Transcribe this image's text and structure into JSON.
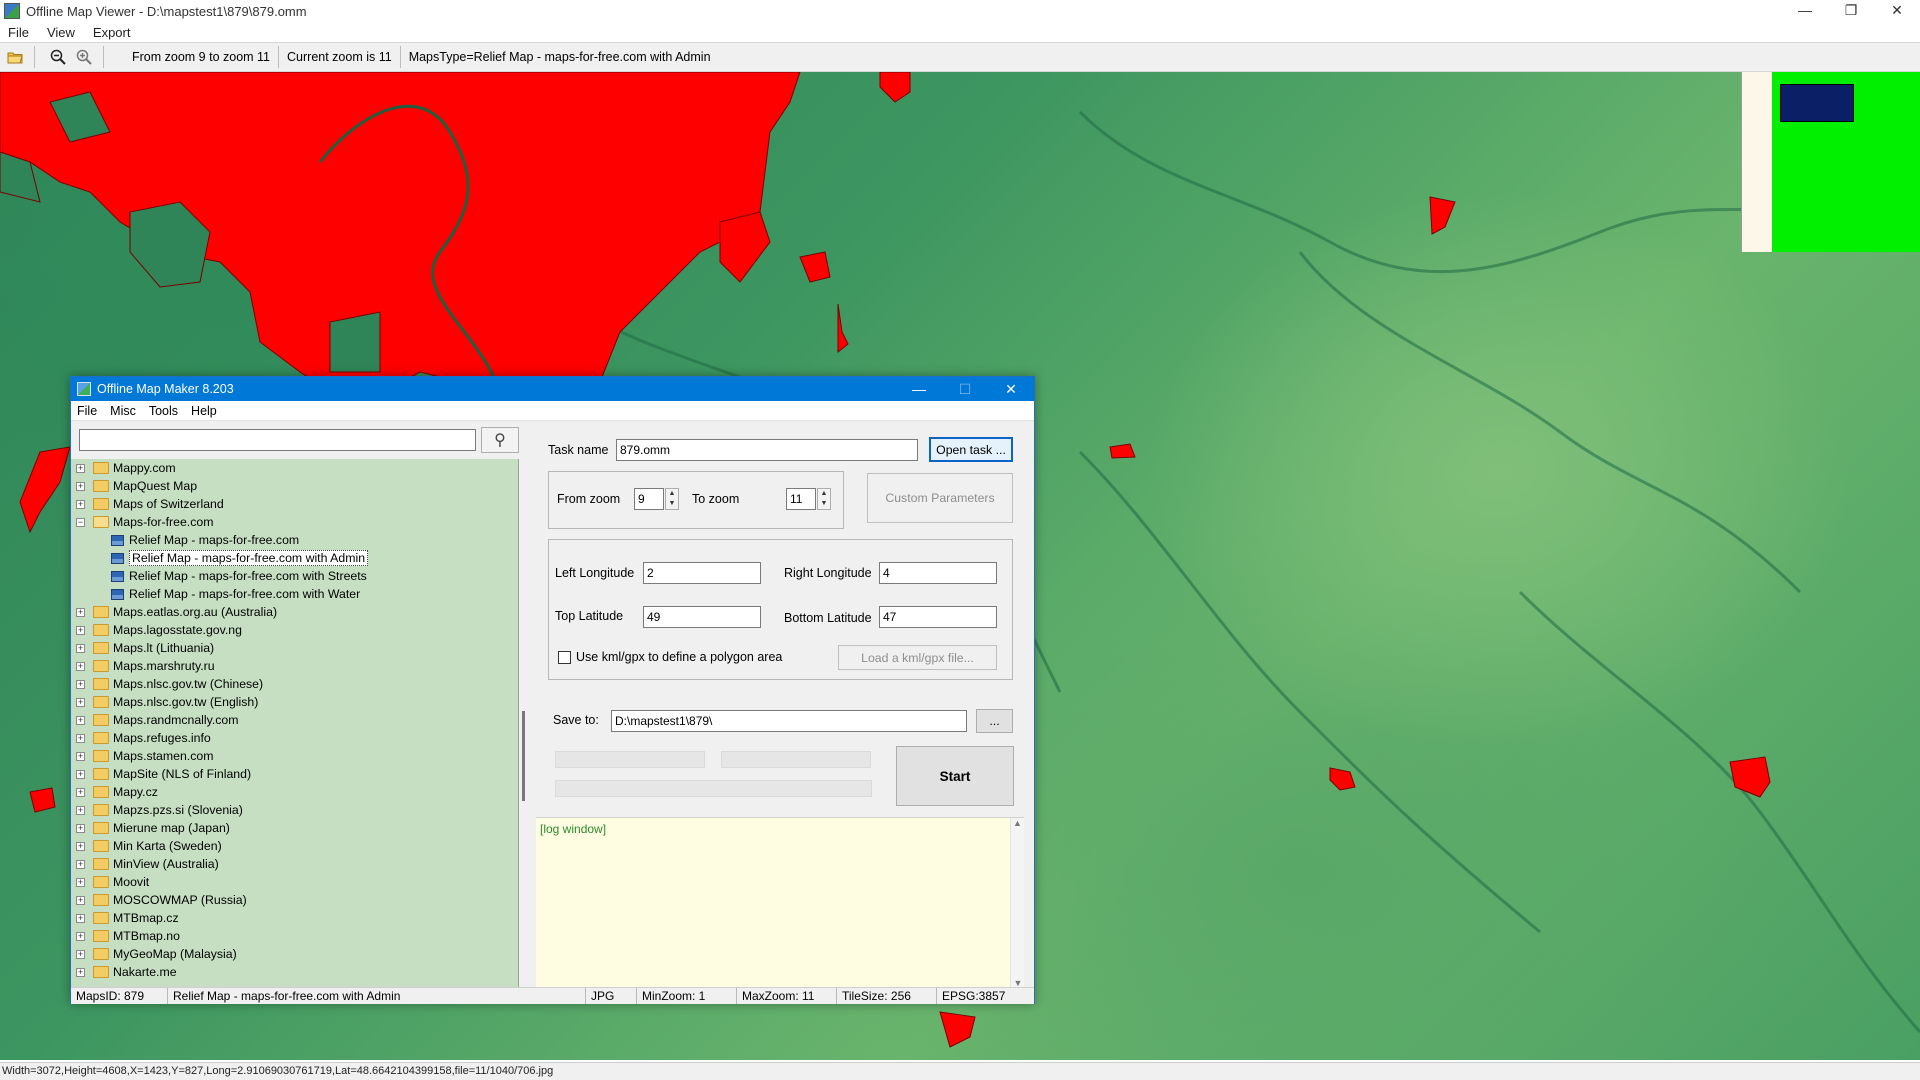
{
  "viewer": {
    "title": "Offline Map Viewer - D:\\mapstest1\\879\\879.omm",
    "window_controls": {
      "minimize": "—",
      "restore": "❐",
      "close": "✕"
    },
    "menu": [
      "File",
      "View",
      "Export"
    ],
    "toolbar": {
      "icons": [
        "folder-open-icon",
        "zoom-out-icon",
        "zoom-in-icon"
      ],
      "zoom_range": "From zoom 9 to zoom 11",
      "current_zoom": "Current zoom is 11",
      "maps_type": "MapsType=Relief Map - maps-for-free.com with Admin"
    },
    "status": "Width=3072,Height=4608,X=1423,Y=827,Long=2.91069030761719,Lat=48.6642104399158,file=11/1040/706.jpg"
  },
  "map": {
    "admin_color": "#ff0000",
    "terrain_color": "#3d9660",
    "overview_colors": {
      "background": "#fdf7ea",
      "area": "#00f000",
      "viewport": "#0a1f66"
    }
  },
  "dialog": {
    "title": "Offline Map Maker 8.203",
    "window_controls": {
      "minimize": "—",
      "maximize": "☐",
      "close": "✕"
    },
    "menu": [
      "File",
      "Misc",
      "Tools",
      "Help"
    ],
    "search": {
      "value": "",
      "button_icon": "search-icon",
      "button_glyph": "⚲"
    },
    "tree": [
      {
        "label": "Mappy.com",
        "level": 0,
        "expanded": false
      },
      {
        "label": "MapQuest Map",
        "level": 0,
        "expanded": false
      },
      {
        "label": "Maps of Switzerland",
        "level": 0,
        "expanded": false
      },
      {
        "label": "Maps-for-free.com",
        "level": 0,
        "expanded": true
      },
      {
        "label": "Relief Map - maps-for-free.com",
        "level": 1
      },
      {
        "label": "Relief Map - maps-for-free.com with Admin",
        "level": 1,
        "selected": true
      },
      {
        "label": "Relief Map - maps-for-free.com with Streets",
        "level": 1
      },
      {
        "label": "Relief Map - maps-for-free.com with Water",
        "level": 1
      },
      {
        "label": "Maps.eatlas.org.au (Australia)",
        "level": 0,
        "expanded": false
      },
      {
        "label": "Maps.lagosstate.gov.ng",
        "level": 0,
        "expanded": false
      },
      {
        "label": "Maps.lt (Lithuania)",
        "level": 0,
        "expanded": false
      },
      {
        "label": "Maps.marshruty.ru",
        "level": 0,
        "expanded": false
      },
      {
        "label": "Maps.nlsc.gov.tw (Chinese)",
        "level": 0,
        "expanded": false
      },
      {
        "label": "Maps.nlsc.gov.tw (English)",
        "level": 0,
        "expanded": false
      },
      {
        "label": "Maps.randmcnally.com",
        "level": 0,
        "expanded": false
      },
      {
        "label": "Maps.refuges.info",
        "level": 0,
        "expanded": false
      },
      {
        "label": "Maps.stamen.com",
        "level": 0,
        "expanded": false
      },
      {
        "label": "MapSite (NLS of Finland)",
        "level": 0,
        "expanded": false
      },
      {
        "label": "Mapy.cz",
        "level": 0,
        "expanded": false
      },
      {
        "label": "Mapzs.pzs.si (Slovenia)",
        "level": 0,
        "expanded": false
      },
      {
        "label": "Mierune map (Japan)",
        "level": 0,
        "expanded": false
      },
      {
        "label": "Min Karta (Sweden)",
        "level": 0,
        "expanded": false
      },
      {
        "label": "MinView (Australia)",
        "level": 0,
        "expanded": false
      },
      {
        "label": "Moovit",
        "level": 0,
        "expanded": false
      },
      {
        "label": "MOSCOWMAP (Russia)",
        "level": 0,
        "expanded": false
      },
      {
        "label": "MTBmap.cz",
        "level": 0,
        "expanded": false
      },
      {
        "label": "MTBmap.no",
        "level": 0,
        "expanded": false
      },
      {
        "label": "MyGeoMap (Malaysia)",
        "level": 0,
        "expanded": false
      },
      {
        "label": "Nakarte.me",
        "level": 0,
        "expanded": false
      }
    ],
    "task": {
      "name_label": "Task name",
      "name_value": "879.omm",
      "open_button": "Open task ...",
      "from_zoom_label": "From zoom",
      "from_zoom": "9",
      "to_zoom_label": "To zoom",
      "to_zoom": "11",
      "custom_params_button": "Custom Parameters",
      "left_lon_label": "Left Longitude",
      "left_lon": "2",
      "right_lon_label": "Right Longitude",
      "right_lon": "4",
      "top_lat_label": "Top Latitude",
      "top_lat": "49",
      "bottom_lat_label": "Bottom Latitude",
      "bottom_lat": "47",
      "kml_checkbox_label": "Use kml/gpx to define a polygon area",
      "kml_checked": false,
      "load_kml_button": "Load a kml/gpx file...",
      "save_to_label": "Save to:",
      "save_to": "D:\\mapstest1\\879\\",
      "browse_button": "...",
      "start_button": "Start",
      "log_text": "[log window]"
    },
    "status": {
      "maps_id": "MapsID: 879",
      "map_name": "Relief Map - maps-for-free.com with Admin",
      "format": "JPG",
      "min_zoom": "MinZoom: 1",
      "max_zoom": "MaxZoom: 11",
      "tile_size": "TileSize: 256",
      "epsg": "EPSG:3857"
    }
  }
}
